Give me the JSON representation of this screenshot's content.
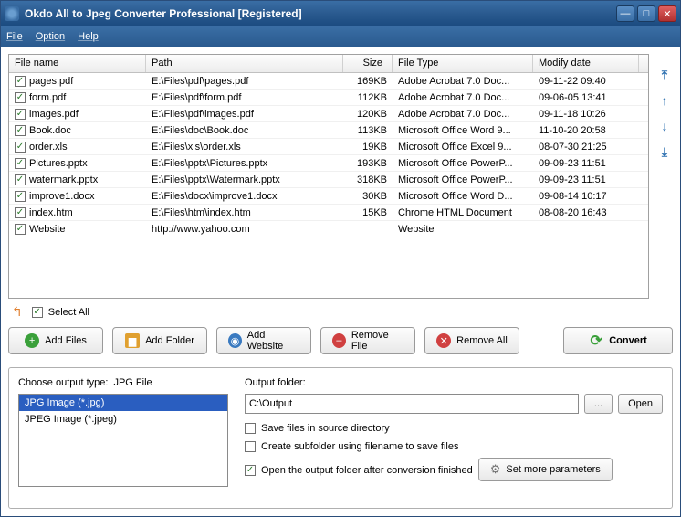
{
  "title": "Okdo All to Jpeg Converter Professional [Registered]",
  "menu": {
    "file": "File",
    "option": "Option",
    "help": "Help"
  },
  "columns": {
    "name": "File name",
    "path": "Path",
    "size": "Size",
    "type": "File Type",
    "date": "Modify date"
  },
  "rows": [
    {
      "name": "pages.pdf",
      "path": "E:\\Files\\pdf\\pages.pdf",
      "size": "169KB",
      "type": "Adobe Acrobat 7.0 Doc...",
      "date": "09-11-22 09:40",
      "checked": true
    },
    {
      "name": "form.pdf",
      "path": "E:\\Files\\pdf\\form.pdf",
      "size": "112KB",
      "type": "Adobe Acrobat 7.0 Doc...",
      "date": "09-06-05 13:41",
      "checked": true
    },
    {
      "name": "images.pdf",
      "path": "E:\\Files\\pdf\\images.pdf",
      "size": "120KB",
      "type": "Adobe Acrobat 7.0 Doc...",
      "date": "09-11-18 10:26",
      "checked": true
    },
    {
      "name": "Book.doc",
      "path": "E:\\Files\\doc\\Book.doc",
      "size": "113KB",
      "type": "Microsoft Office Word 9...",
      "date": "11-10-20 20:58",
      "checked": true
    },
    {
      "name": "order.xls",
      "path": "E:\\Files\\xls\\order.xls",
      "size": "19KB",
      "type": "Microsoft Office Excel 9...",
      "date": "08-07-30 21:25",
      "checked": true
    },
    {
      "name": "Pictures.pptx",
      "path": "E:\\Files\\pptx\\Pictures.pptx",
      "size": "193KB",
      "type": "Microsoft Office PowerP...",
      "date": "09-09-23 11:51",
      "checked": true
    },
    {
      "name": "watermark.pptx",
      "path": "E:\\Files\\pptx\\Watermark.pptx",
      "size": "318KB",
      "type": "Microsoft Office PowerP...",
      "date": "09-09-23 11:51",
      "checked": true
    },
    {
      "name": "improve1.docx",
      "path": "E:\\Files\\docx\\improve1.docx",
      "size": "30KB",
      "type": "Microsoft Office Word D...",
      "date": "09-08-14 10:17",
      "checked": true
    },
    {
      "name": "index.htm",
      "path": "E:\\Files\\htm\\index.htm",
      "size": "15KB",
      "type": "Chrome HTML Document",
      "date": "08-08-20 16:43",
      "checked": true
    },
    {
      "name": "Website",
      "path": "http://www.yahoo.com",
      "size": "",
      "type": "Website",
      "date": "",
      "checked": true
    }
  ],
  "select_all": "Select All",
  "buttons": {
    "add_files": "Add Files",
    "add_folder": "Add Folder",
    "add_website": "Add Website",
    "remove_file": "Remove File",
    "remove_all": "Remove All",
    "convert": "Convert"
  },
  "output_type": {
    "label": "Choose output type:",
    "current": "JPG File",
    "options": [
      "JPG Image (*.jpg)",
      "JPEG Image (*.jpeg)"
    ]
  },
  "output": {
    "label": "Output folder:",
    "value": "C:\\Output",
    "browse": "...",
    "open": "Open",
    "opt_save_source": "Save files in source directory",
    "opt_subfolder": "Create subfolder using filename to save files",
    "opt_open_after": "Open the output folder after conversion finished",
    "params": "Set more parameters"
  },
  "checks": {
    "select_all": true,
    "save_source": false,
    "subfolder": false,
    "open_after": true
  }
}
